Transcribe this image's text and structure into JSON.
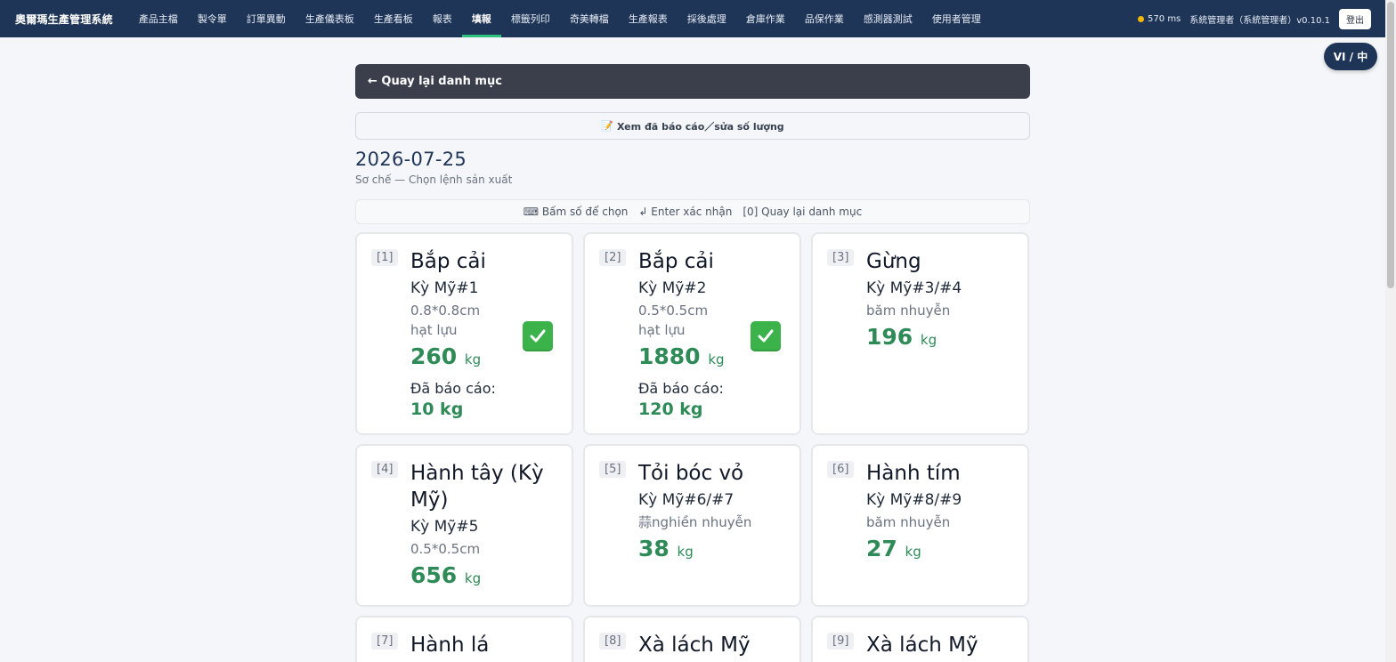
{
  "app": {
    "brand": "奧爾瑪生產管理系統",
    "nav": [
      "產品主檔",
      "製令單",
      "訂單異動",
      "生產儀表板",
      "生產看板",
      "報表",
      "填報",
      "標籤列印",
      "奇美轉檔",
      "生產報表",
      "採後處理",
      "倉庫作業",
      "品保作業",
      "感測器測試",
      "使用者管理"
    ],
    "active_nav_index": 6,
    "latency": "570 ms",
    "user": "系統管理者（系統管理者）v0.10.1",
    "logout": "登出",
    "lang_toggle": "VI / 中"
  },
  "page": {
    "back_label": "← Quay lại danh mục",
    "reported_label": "Xem đã báo cáo／sửa số lượng",
    "date": "2026-07-25",
    "subtitle": "Sơ chế — Chọn lệnh sản xuất",
    "hints": [
      "⌨ Bấm số để chọn",
      "↲ Enter xác nhận",
      "[0] Quay lại danh mục"
    ]
  },
  "cards": [
    {
      "num": "[1]",
      "title": "Bắp cải",
      "code": "Kỳ Mỹ#1",
      "spec": "0.8*0.8cm hạt lựu",
      "qty": "260",
      "unit": "kg",
      "reported_label": "Đã báo cáo:",
      "reported": "10 kg",
      "checked": true
    },
    {
      "num": "[2]",
      "title": "Bắp cải",
      "code": "Kỳ Mỹ#2",
      "spec": "0.5*0.5cm hạt lựu",
      "qty": "1880",
      "unit": "kg",
      "reported_label": "Đã báo cáo:",
      "reported": "120 kg",
      "checked": true
    },
    {
      "num": "[3]",
      "title": "Gừng",
      "code": "Kỳ Mỹ#3/#4",
      "spec": "băm nhuyễn",
      "qty": "196",
      "unit": "kg",
      "checked": false
    },
    {
      "num": "[4]",
      "title": "Hành tây (Kỳ Mỹ)",
      "code": "Kỳ Mỹ#5",
      "spec": "0.5*0.5cm",
      "qty": "656",
      "unit": "kg",
      "checked": false
    },
    {
      "num": "[5]",
      "title": "Tỏi bóc vỏ",
      "code": "Kỳ Mỹ#6/#7",
      "spec": "蒜nghiền nhuyễn",
      "qty": "38",
      "unit": "kg",
      "checked": false
    },
    {
      "num": "[6]",
      "title": "Hành tím",
      "code": "Kỳ Mỹ#8/#9",
      "spec": "băm nhuyễn",
      "qty": "27",
      "unit": "kg",
      "checked": false
    },
    {
      "num": "[7]",
      "title": "Hành lá"
    },
    {
      "num": "[8]",
      "title": "Xà lách Mỹ"
    },
    {
      "num": "[9]",
      "title": "Xà lách Mỹ"
    }
  ]
}
